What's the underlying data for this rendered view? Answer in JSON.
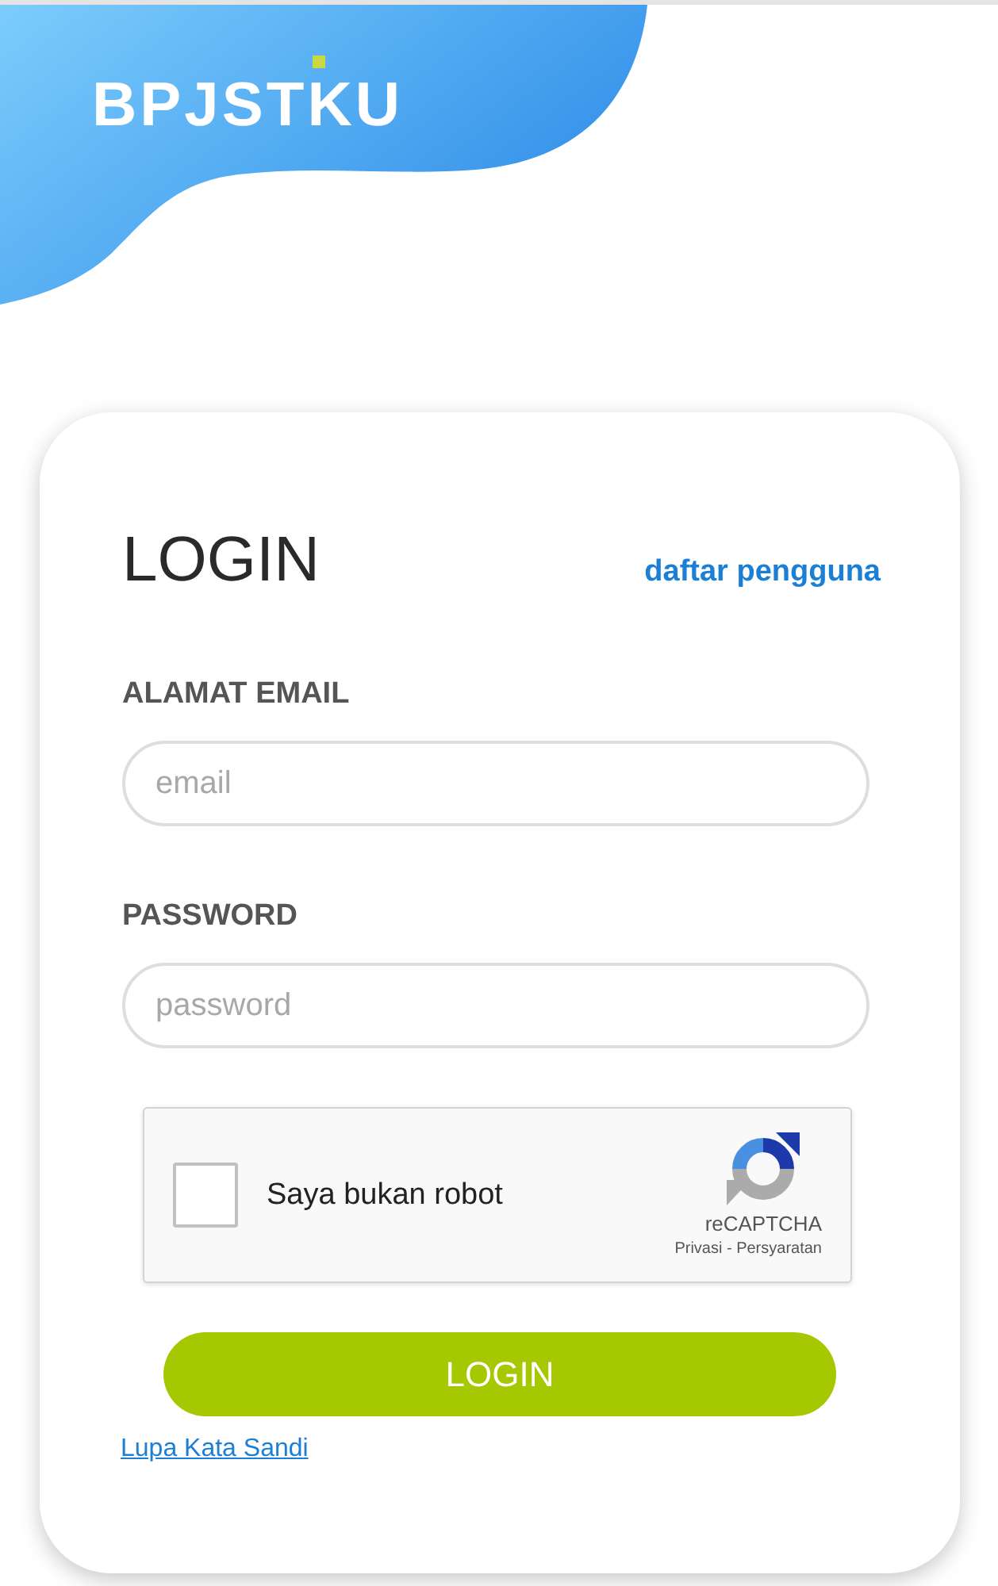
{
  "logo": {
    "text": "BPJSTKU"
  },
  "login_card": {
    "title": "LOGIN",
    "register_link": "daftar pengguna",
    "fields": [
      {
        "label": "ALAMAT EMAIL",
        "placeholder": "email"
      },
      {
        "label": "PASSWORD",
        "placeholder": "password"
      }
    ],
    "recaptcha": {
      "label": "Saya bukan robot",
      "checked": false,
      "brand": "reCAPTCHA",
      "links": "Privasi - Persyaratan"
    },
    "submit_button": "LOGIN",
    "forgot_password_link": "Lupa Kata Sandi"
  }
}
